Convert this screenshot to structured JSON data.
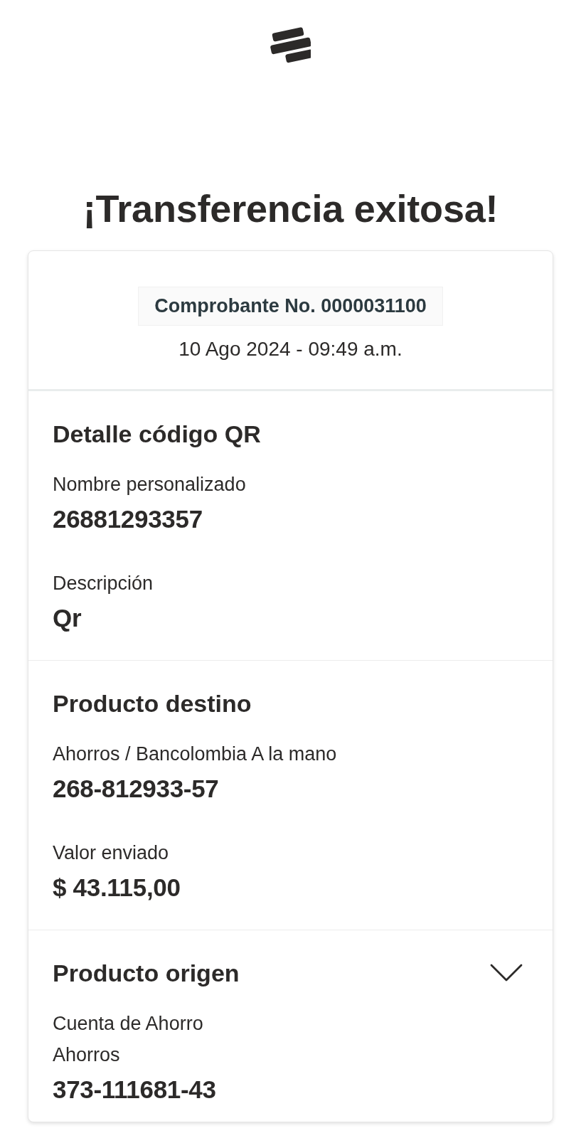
{
  "title": "¡Transferencia exitosa!",
  "receipt": {
    "number": "Comprobante No. 0000031100",
    "date": "10 Ago 2024 - 09:49 a.m."
  },
  "sections": [
    {
      "title": "Detalle código QR",
      "collapsible": false,
      "items": [
        {
          "kind": "label",
          "text": "Nombre personalizado"
        },
        {
          "kind": "value",
          "text": "26881293357"
        },
        {
          "kind": "label",
          "text": "Descripción"
        },
        {
          "kind": "value",
          "text": "Qr"
        }
      ]
    },
    {
      "title": "Producto destino",
      "collapsible": false,
      "items": [
        {
          "kind": "label",
          "text": "Ahorros / Bancolombia A la mano"
        },
        {
          "kind": "value",
          "text": "268-812933-57"
        },
        {
          "kind": "label",
          "text": "Valor enviado"
        },
        {
          "kind": "value",
          "text": "$ 43.115,00"
        }
      ]
    },
    {
      "title": "Producto origen",
      "collapsible": true,
      "items": [
        {
          "kind": "label",
          "text": "Cuenta de Ahorro"
        },
        {
          "kind": "label",
          "text": "Ahorros"
        },
        {
          "kind": "value",
          "text": "373-111681-43"
        }
      ]
    }
  ]
}
